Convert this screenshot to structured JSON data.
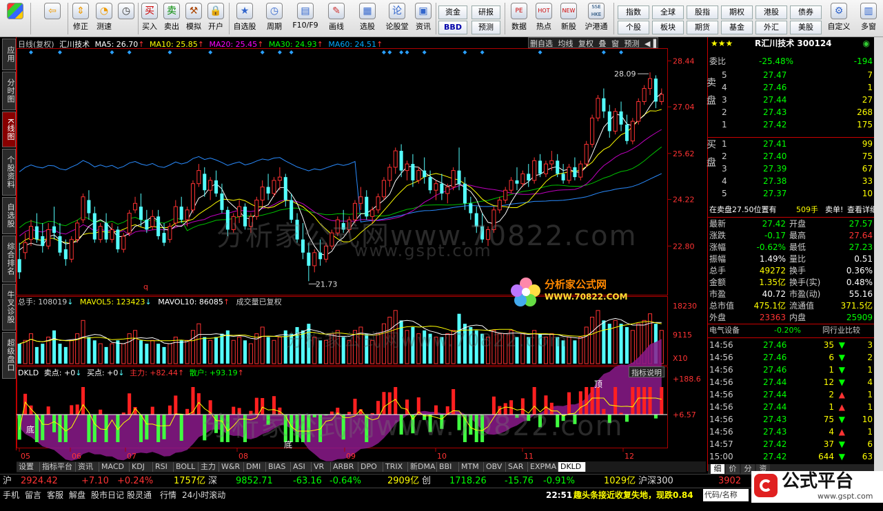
{
  "toolbar": {
    "buttons": [
      {
        "label": "",
        "icon": "windows-icon"
      },
      {
        "label": "",
        "icon": "back-arrow-icon"
      },
      {
        "label": "修正",
        "icon": "up-down-arrows-icon"
      },
      {
        "label": "测速",
        "icon": "speed-clock-icon"
      },
      {
        "label": "买入",
        "icon": "buy-icon"
      },
      {
        "label": "卖出",
        "icon": "sell-icon"
      },
      {
        "label": "模拟",
        "icon": "hammer-icon"
      },
      {
        "label": "开户",
        "icon": "lock-icon"
      },
      {
        "label": "自选股",
        "icon": "star-icon"
      },
      {
        "label": "周期",
        "icon": "clock-icon"
      },
      {
        "label": "F10/F9",
        "icon": "document-icon"
      },
      {
        "label": "画线",
        "icon": "pencil-icon"
      },
      {
        "label": "选股",
        "icon": "grid-icon"
      },
      {
        "label": "论股堂",
        "icon": "forum-icon"
      },
      {
        "label": "资讯",
        "icon": "news-icon"
      }
    ],
    "small_buttons": [
      [
        "资金",
        "BBD"
      ],
      [
        "研报",
        "预测"
      ],
      [
        "数据",
        "热点"
      ],
      [
        "新股",
        "沪港通"
      ]
    ],
    "small_icons": [
      "PE",
      "HOT",
      "NEW",
      "SSE HKE"
    ],
    "right_buttons": [
      [
        "指数",
        "个股"
      ],
      [
        "全球",
        "板块"
      ],
      [
        "股指",
        "期货"
      ],
      [
        "期权",
        "基金"
      ],
      [
        "港股",
        "外汇"
      ],
      [
        "债券",
        "美股"
      ]
    ],
    "last_buttons": [
      "自定义",
      "多窗"
    ],
    "bbd_label": "BBD"
  },
  "sidetabs": [
    {
      "label": "应用",
      "active": false
    },
    {
      "label": "分时图",
      "active": false
    },
    {
      "label": "K线图",
      "active": true
    },
    {
      "label": "个股资料",
      "active": false
    },
    {
      "label": "自选股",
      "active": false
    },
    {
      "label": "综合排名",
      "active": false
    },
    {
      "label": "牛叉诊股",
      "active": false
    },
    {
      "label": "超级盘口",
      "active": false
    }
  ],
  "kline": {
    "header": "日线(复权)",
    "stock": "汇川技术",
    "ma": [
      {
        "label": "MA5: 26.70",
        "color": "#ffffff"
      },
      {
        "label": "MA10: 25.85",
        "color": "#ffff00"
      },
      {
        "label": "MA20: 25.45",
        "color": "#ff00ff"
      },
      {
        "label": "MA30: 24.93",
        "color": "#00ff00"
      },
      {
        "label": "MA60: 24.51",
        "color": "#00a8ff"
      }
    ],
    "buttons": [
      "删自选",
      "均线",
      "复权",
      "叠",
      "窗",
      "预测"
    ],
    "price_ticks": [
      "28.44",
      "27.04",
      "25.62",
      "24.22",
      "22.80"
    ],
    "high_label": "28.09",
    "low_label": "21.73",
    "q_marker": "q"
  },
  "volume": {
    "legend_total": "总手: 108019",
    "legend_ma5": "MAVOL5: 123423",
    "legend_ma10": "MAVOL10: 86085",
    "legend_note": "成交量已复权",
    "ticks": [
      "18230",
      "9115",
      "X10"
    ]
  },
  "dkld": {
    "legend_name": "DKLD",
    "legend_sell": "卖点: +0",
    "legend_buy": "买点: +0",
    "legend_main": "主力: +82.44",
    "legend_retail": "散户: +93.19",
    "explain_btn": "指标说明",
    "ticks": [
      "+188.6",
      "+6.57"
    ],
    "top_marker": "顶",
    "bottom_marker": "底"
  },
  "x_labels": [
    "05",
    "06",
    "07",
    "08",
    "09",
    "10",
    "11",
    "12"
  ],
  "watermarks": {
    "main": "分析家公式网www.70822.com",
    "sub": "www.gspt.com",
    "logo_cn": "分析家公式网",
    "logo_url": "WWW.70822.COM"
  },
  "quote": {
    "title": "R汇川技术 300124",
    "webi_label": "委比",
    "webi_value": "-25.48%",
    "webi_diff": "-194",
    "sell_label": "卖盘",
    "buy_label": "买盘",
    "sell": [
      {
        "lv": "5",
        "price": "27.47",
        "vol": "7"
      },
      {
        "lv": "4",
        "price": "27.46",
        "vol": "1"
      },
      {
        "lv": "3",
        "price": "27.44",
        "vol": "27"
      },
      {
        "lv": "2",
        "price": "27.43",
        "vol": "268"
      },
      {
        "lv": "1",
        "price": "27.42",
        "vol": "175"
      }
    ],
    "buy": [
      {
        "lv": "1",
        "price": "27.41",
        "vol": "99"
      },
      {
        "lv": "2",
        "price": "27.40",
        "vol": "75"
      },
      {
        "lv": "3",
        "price": "27.39",
        "vol": "67"
      },
      {
        "lv": "4",
        "price": "27.38",
        "vol": "33"
      },
      {
        "lv": "5",
        "price": "27.37",
        "vol": "10"
      }
    ],
    "sell_info": "在卖盘27.50位置有",
    "sell_info_vol": "509手",
    "sell_info_tag": "卖单!",
    "sell_info_link": "查看详细",
    "stats": [
      [
        "最新",
        "27.42",
        "开盘",
        "27.57"
      ],
      [
        "涨跌",
        "-0.17",
        "最高",
        "27.64"
      ],
      [
        "涨幅",
        "-0.62%",
        "最低",
        "27.23"
      ],
      [
        "振幅",
        "1.49%",
        "量比",
        "0.51"
      ],
      [
        "总手",
        "49272",
        "换手",
        "0.36%"
      ],
      [
        "金额",
        "1.35亿",
        "换手(实)",
        "0.48%"
      ],
      [
        "市盈",
        "40.72",
        "市盈(动)",
        "55.16"
      ],
      [
        "总市值",
        "475.1亿",
        "流通值",
        "371.5亿"
      ],
      [
        "外盘",
        "23363",
        "内盘",
        "25909"
      ]
    ],
    "industry": "电气设备",
    "industry_pct": "-0.20%",
    "industry_cmp": "同行业比较",
    "ticks": [
      {
        "t": "14:56",
        "p": "27.46",
        "v": "35",
        "dir": "down",
        "n": "3"
      },
      {
        "t": "14:56",
        "p": "27.46",
        "v": "6",
        "dir": "down",
        "n": "2"
      },
      {
        "t": "14:56",
        "p": "27.46",
        "v": "1",
        "dir": "down",
        "n": "1"
      },
      {
        "t": "14:56",
        "p": "27.44",
        "v": "12",
        "dir": "down",
        "n": "4"
      },
      {
        "t": "14:56",
        "p": "27.44",
        "v": "2",
        "dir": "up",
        "n": "1"
      },
      {
        "t": "14:56",
        "p": "27.44",
        "v": "1",
        "dir": "up",
        "n": "1"
      },
      {
        "t": "14:56",
        "p": "27.43",
        "v": "75",
        "dir": "down",
        "n": "10"
      },
      {
        "t": "14:56",
        "p": "27.43",
        "v": "4",
        "dir": "up",
        "n": "1"
      },
      {
        "t": "14:57",
        "p": "27.42",
        "v": "37",
        "dir": "down",
        "n": "6"
      },
      {
        "t": "15:00",
        "p": "27.42",
        "v": "644",
        "dir": "down",
        "n": "63"
      }
    ],
    "tabs": [
      "细",
      "价",
      "分",
      "资"
    ]
  },
  "bottom_tabs": [
    "设置",
    "指标平台",
    "资讯",
    "MACD",
    "KDJ",
    "RSI",
    "BOLL",
    "主力",
    "W&R",
    "DMI",
    "BIAS",
    "ASI",
    "VR",
    "ARBR",
    "DPO",
    "TRIX",
    "新DMA",
    "BBI",
    "MTM",
    "OBV",
    "SAR",
    "EXPMA",
    "DKLD"
  ],
  "index_bar": {
    "sh_label": "沪",
    "sh_val": "2924.42",
    "sh_chg": "+7.10",
    "sh_pct": "+0.24%",
    "sh_amt": "1757亿",
    "sz_label": "深",
    "sz_val": "9852.71",
    "sz_chg": "-63.16",
    "sz_pct": "-0.64%",
    "sz_amt": "2909亿",
    "cy_label": "创",
    "cy_val": "1718.26",
    "cy_chg": "-15.76",
    "cy_pct": "-0.91%",
    "cy_amt": "1029亿",
    "hs_label": "沪深300",
    "hs_val": "3902"
  },
  "status": {
    "items": [
      "手机",
      "留言",
      "客服",
      "解盘",
      "股市日记",
      "股灵通",
      "行情",
      "24小时滚动"
    ],
    "time": "22:51",
    "headline": "趣头条接近收复失地，现跌0.84",
    "search": "代码/名称"
  },
  "brand": {
    "name": "公式平台",
    "url": "www.gspt.com"
  },
  "colors": {
    "up": "#ff3232",
    "down": "#54ffff",
    "yellow": "#ffff00",
    "accent": "#c00000"
  },
  "chart_data": {
    "type": "candlestick",
    "title": "汇川技术 日线(复权)",
    "price_range": [
      21.4,
      28.7
    ],
    "x_months": [
      "05",
      "06",
      "07",
      "08",
      "09",
      "10",
      "11",
      "12"
    ],
    "high": 28.09,
    "low": 21.73,
    "ma_last": {
      "MA5": 26.7,
      "MA10": 25.85,
      "MA20": 25.45,
      "MA30": 24.93,
      "MA60": 24.51
    },
    "volume_max": 18230,
    "candles": [
      [
        22.4,
        22.9,
        22.0,
        21.8
      ],
      [
        22.6,
        23.2,
        22.9,
        22.4
      ],
      [
        23.0,
        23.6,
        23.4,
        22.8
      ],
      [
        23.4,
        23.8,
        23.0,
        22.9
      ],
      [
        23.1,
        23.5,
        22.8,
        22.6
      ],
      [
        22.8,
        23.5,
        23.3,
        22.7
      ],
      [
        23.4,
        24.0,
        23.2,
        23.0
      ],
      [
        23.1,
        23.5,
        22.6,
        22.5
      ],
      [
        22.7,
        23.0,
        22.4,
        22.2
      ],
      [
        22.4,
        23.1,
        23.0,
        22.3
      ],
      [
        23.0,
        23.6,
        23.5,
        22.9
      ],
      [
        23.6,
        24.4,
        24.3,
        23.5
      ],
      [
        24.2,
        24.5,
        23.8,
        23.6
      ],
      [
        23.8,
        24.0,
        23.0,
        22.9
      ],
      [
        23.0,
        23.5,
        23.4,
        22.9
      ],
      [
        23.5,
        23.8,
        23.0,
        22.9
      ],
      [
        23.0,
        23.5,
        23.3,
        22.9
      ],
      [
        23.3,
        23.4,
        22.7,
        22.6
      ],
      [
        22.7,
        23.2,
        23.1,
        22.6
      ],
      [
        23.2,
        23.9,
        23.8,
        23.1
      ],
      [
        23.9,
        24.3,
        24.1,
        23.8
      ],
      [
        24.0,
        24.4,
        23.6,
        23.4
      ],
      [
        23.6,
        23.9,
        23.3,
        23.2
      ],
      [
        23.4,
        23.9,
        23.7,
        23.3
      ],
      [
        23.7,
        23.9,
        23.1,
        23.0
      ],
      [
        23.2,
        23.5,
        22.9,
        22.8
      ],
      [
        23.0,
        23.5,
        23.4,
        22.9
      ],
      [
        23.5,
        24.2,
        24.0,
        23.4
      ],
      [
        24.0,
        24.3,
        23.6,
        23.5
      ],
      [
        23.6,
        24.0,
        23.9,
        23.4
      ],
      [
        23.9,
        24.8,
        24.7,
        23.8
      ],
      [
        24.7,
        25.3,
        25.1,
        24.6
      ],
      [
        25.0,
        25.2,
        24.5,
        24.3
      ],
      [
        24.5,
        24.9,
        24.8,
        24.2
      ],
      [
        24.8,
        25.1,
        24.4,
        24.3
      ],
      [
        24.4,
        24.7,
        23.9,
        23.8
      ],
      [
        23.9,
        24.0,
        23.3,
        23.1
      ],
      [
        23.3,
        23.8,
        23.7,
        23.2
      ],
      [
        23.7,
        24.2,
        24.0,
        23.5
      ],
      [
        24.0,
        24.1,
        23.4,
        23.3
      ],
      [
        23.4,
        23.8,
        23.7,
        23.2
      ],
      [
        23.7,
        24.3,
        24.2,
        23.6
      ],
      [
        24.2,
        24.8,
        24.6,
        24.0
      ],
      [
        24.6,
        25.0,
        24.4,
        24.2
      ],
      [
        24.4,
        24.9,
        24.8,
        24.3
      ],
      [
        24.8,
        25.2,
        24.9,
        24.5
      ],
      [
        24.9,
        25.0,
        24.2,
        24.0
      ],
      [
        24.2,
        24.4,
        23.6,
        23.5
      ],
      [
        23.6,
        23.8,
        23.0,
        22.9
      ],
      [
        23.0,
        23.5,
        22.6,
        22.4
      ],
      [
        22.6,
        22.9,
        22.2,
        21.73
      ],
      [
        22.2,
        22.7,
        22.6,
        22.0
      ],
      [
        22.6,
        23.0,
        22.4,
        22.2
      ],
      [
        22.4,
        22.9,
        22.8,
        22.3
      ],
      [
        22.8,
        23.3,
        23.2,
        22.7
      ],
      [
        23.2,
        23.7,
        23.6,
        23.1
      ],
      [
        23.5,
        23.9,
        23.3,
        23.2
      ],
      [
        23.3,
        23.7,
        23.6,
        23.2
      ],
      [
        23.6,
        24.2,
        24.1,
        23.5
      ],
      [
        24.1,
        24.6,
        24.3,
        23.9
      ],
      [
        24.3,
        24.5,
        23.7,
        23.6
      ],
      [
        23.7,
        24.0,
        23.9,
        23.5
      ],
      [
        23.9,
        24.4,
        24.3,
        23.8
      ],
      [
        24.3,
        24.9,
        24.8,
        24.2
      ],
      [
        24.8,
        25.3,
        25.2,
        24.6
      ],
      [
        25.2,
        25.8,
        25.7,
        25.0
      ],
      [
        25.7,
        25.9,
        25.1,
        24.9
      ],
      [
        25.1,
        25.4,
        25.3,
        24.8
      ],
      [
        25.3,
        25.6,
        24.8,
        24.6
      ],
      [
        24.8,
        25.2,
        25.1,
        24.7
      ],
      [
        25.1,
        25.5,
        24.9,
        24.7
      ],
      [
        24.9,
        25.1,
        24.5,
        24.4
      ],
      [
        24.5,
        24.8,
        24.7,
        24.2
      ],
      [
        24.7,
        25.0,
        24.4,
        24.2
      ],
      [
        24.4,
        24.7,
        24.6,
        24.1
      ],
      [
        24.6,
        25.2,
        25.1,
        24.5
      ],
      [
        25.1,
        25.8,
        24.7,
        24.5
      ],
      [
        24.7,
        24.9,
        24.1,
        23.9
      ],
      [
        24.1,
        24.3,
        23.8,
        23.6
      ],
      [
        23.8,
        24.0,
        23.4,
        23.2
      ],
      [
        23.4,
        23.8,
        23.0,
        22.9
      ],
      [
        23.0,
        23.4,
        23.3,
        22.8
      ],
      [
        23.3,
        24.0,
        23.9,
        23.2
      ],
      [
        23.9,
        24.3,
        24.2,
        23.8
      ],
      [
        24.2,
        24.6,
        24.5,
        24.1
      ],
      [
        24.5,
        24.9,
        24.8,
        24.4
      ],
      [
        24.8,
        25.2,
        24.7,
        24.5
      ],
      [
        24.7,
        25.1,
        25.0,
        24.6
      ],
      [
        25.0,
        25.3,
        24.8,
        24.6
      ],
      [
        24.8,
        25.5,
        25.4,
        24.7
      ],
      [
        25.4,
        25.6,
        25.0,
        24.9
      ],
      [
        25.0,
        25.4,
        25.3,
        24.9
      ],
      [
        25.3,
        25.7,
        25.4,
        25.1
      ],
      [
        25.4,
        25.6,
        25.0,
        24.9
      ],
      [
        25.0,
        25.3,
        24.8,
        24.7
      ],
      [
        24.8,
        25.3,
        25.2,
        24.7
      ],
      [
        25.2,
        25.5,
        24.9,
        24.8
      ],
      [
        24.9,
        25.4,
        25.3,
        24.8
      ],
      [
        25.3,
        26.0,
        25.9,
        25.2
      ],
      [
        25.9,
        26.8,
        26.7,
        25.8
      ],
      [
        26.7,
        27.4,
        27.3,
        26.6
      ],
      [
        27.3,
        27.6,
        26.9,
        26.7
      ],
      [
        26.9,
        27.1,
        26.3,
        26.1
      ],
      [
        26.3,
        27.0,
        26.9,
        26.2
      ],
      [
        26.9,
        27.2,
        26.5,
        26.3
      ],
      [
        26.5,
        26.8,
        26.0,
        25.9
      ],
      [
        26.0,
        26.7,
        26.6,
        25.9
      ],
      [
        26.6,
        27.3,
        27.2,
        26.5
      ],
      [
        27.2,
        27.7,
        27.6,
        27.1
      ],
      [
        27.6,
        28.09,
        27.9,
        27.4
      ],
      [
        27.9,
        28.0,
        27.2,
        27.0
      ],
      [
        27.2,
        27.6,
        27.42,
        27.1
      ]
    ],
    "volumes": [
      6,
      7,
      9,
      5,
      6,
      8,
      10,
      6,
      5,
      7,
      9,
      13,
      8,
      7,
      6,
      5,
      6,
      7,
      6,
      9,
      10,
      7,
      6,
      7,
      6,
      5,
      6,
      8,
      7,
      7,
      10,
      12,
      8,
      7,
      8,
      9,
      10,
      7,
      8,
      7,
      6,
      9,
      11,
      8,
      7,
      8,
      10,
      9,
      11,
      10,
      12,
      8,
      7,
      7,
      9,
      10,
      8,
      7,
      10,
      11,
      9,
      7,
      9,
      12,
      14,
      16,
      13,
      10,
      11,
      9,
      10,
      9,
      8,
      8,
      9,
      10,
      15,
      12,
      11,
      10,
      9,
      8,
      10,
      9,
      9,
      10,
      8,
      9,
      8,
      10,
      9,
      8,
      9,
      8,
      7,
      8,
      7,
      8,
      11,
      14,
      16,
      13,
      12,
      13,
      12,
      11,
      10,
      12,
      13,
      15,
      12,
      10
    ]
  }
}
